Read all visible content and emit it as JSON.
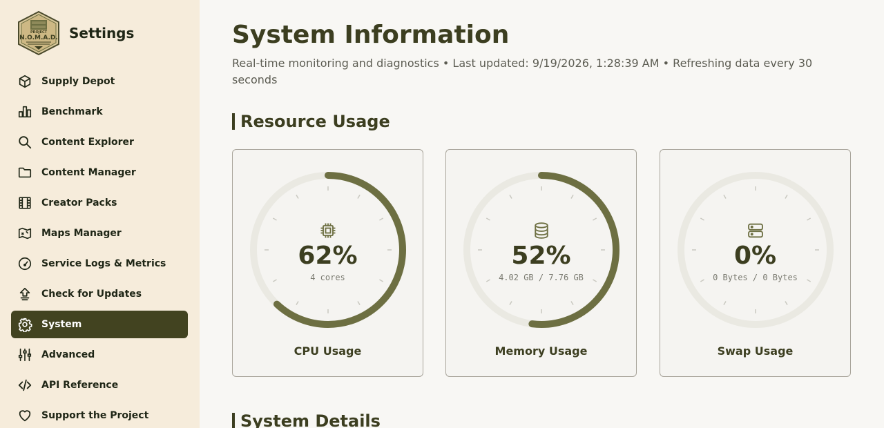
{
  "sidebar": {
    "brand_title": "Settings",
    "logo": {
      "line1": "PROJECT",
      "line2": "N.O.M.A.D."
    },
    "items": [
      {
        "label": "Supply Depot",
        "icon": "cube-icon"
      },
      {
        "label": "Benchmark",
        "icon": "bar-chart-icon"
      },
      {
        "label": "Content Explorer",
        "icon": "search-icon"
      },
      {
        "label": "Content Manager",
        "icon": "folder-icon"
      },
      {
        "label": "Creator Packs",
        "icon": "film-icon"
      },
      {
        "label": "Maps Manager",
        "icon": "map-icon"
      },
      {
        "label": "Service Logs & Metrics",
        "icon": "gauge-icon"
      },
      {
        "label": "Check for Updates",
        "icon": "cloud-upload-icon"
      },
      {
        "label": "System",
        "icon": "gear-icon",
        "active": true
      },
      {
        "label": "Advanced",
        "icon": "sliders-icon"
      },
      {
        "label": "API Reference",
        "icon": "code-icon"
      },
      {
        "label": "Support the Project",
        "icon": "heart-icon"
      }
    ]
  },
  "main": {
    "title": "System Information",
    "subtitle": "Real-time monitoring and diagnostics • Last updated: 9/19/2026, 1:28:39 AM • Refreshing data every 30 seconds",
    "sections": {
      "resource_usage": "Resource Usage",
      "system_details": "System Details"
    },
    "gauges": [
      {
        "label": "CPU Usage",
        "value_text": "62%",
        "percent": 62,
        "detail": "4 cores",
        "icon": "cpu-icon"
      },
      {
        "label": "Memory Usage",
        "value_text": "52%",
        "percent": 52,
        "detail": "4.02 GB / 7.76 GB",
        "icon": "database-icon"
      },
      {
        "label": "Swap Usage",
        "value_text": "0%",
        "percent": 0,
        "detail": "0 Bytes / 0 Bytes",
        "icon": "server-icon"
      }
    ]
  },
  "colors": {
    "sidebar_bg": "#f6ecdb",
    "active_bg": "#424320",
    "accent": "#6d6f42",
    "track": "#eae9e2",
    "text_dark": "#3c3e20"
  }
}
